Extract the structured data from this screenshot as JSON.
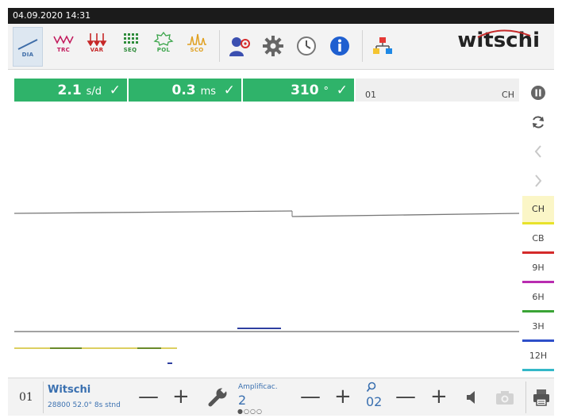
{
  "header": {
    "datetime": "04.09.2020 14:31"
  },
  "toolbar": {
    "tools": [
      {
        "label": "DIA",
        "icon": "diagram-icon"
      },
      {
        "label": "TRC",
        "icon": "trace-icon"
      },
      {
        "label": "VAR",
        "icon": "variation-icon"
      },
      {
        "label": "SEQ",
        "icon": "sequence-icon"
      },
      {
        "label": "POL",
        "icon": "polar-icon"
      },
      {
        "label": "SCO",
        "icon": "scope-icon"
      }
    ],
    "logo": "witschi"
  },
  "status": {
    "rate": {
      "value": "2.1",
      "unit": "s/d",
      "check": "✓"
    },
    "beat_error": {
      "value": "0.3",
      "unit": "ms",
      "check": "✓"
    },
    "amplitude": {
      "value": "310",
      "unit": "°",
      "check": "✓"
    }
  },
  "info": {
    "left": "01",
    "right": "CH"
  },
  "positions": [
    {
      "label": "CH",
      "color": "#e8e22a",
      "active": true
    },
    {
      "label": "CB",
      "color": "#d42a2a",
      "active": false
    },
    {
      "label": "9H",
      "color": "#b92cb0",
      "active": false
    },
    {
      "label": "6H",
      "color": "#3aa436",
      "active": false
    },
    {
      "label": "3H",
      "color": "#2e4fc9",
      "active": false
    },
    {
      "label": "12H",
      "color": "#33b8c8",
      "active": false
    }
  ],
  "bottom": {
    "id": "01",
    "name": "Witschi",
    "details": "28800  52.0°  8s  stnd",
    "amp_label": "Amplificac.",
    "amp_value": "2",
    "amp_dots": "●○○○",
    "zoom_value": "02"
  },
  "colors": {
    "accent_green": "#2fb36a",
    "brand_blue": "#3a70b0"
  }
}
